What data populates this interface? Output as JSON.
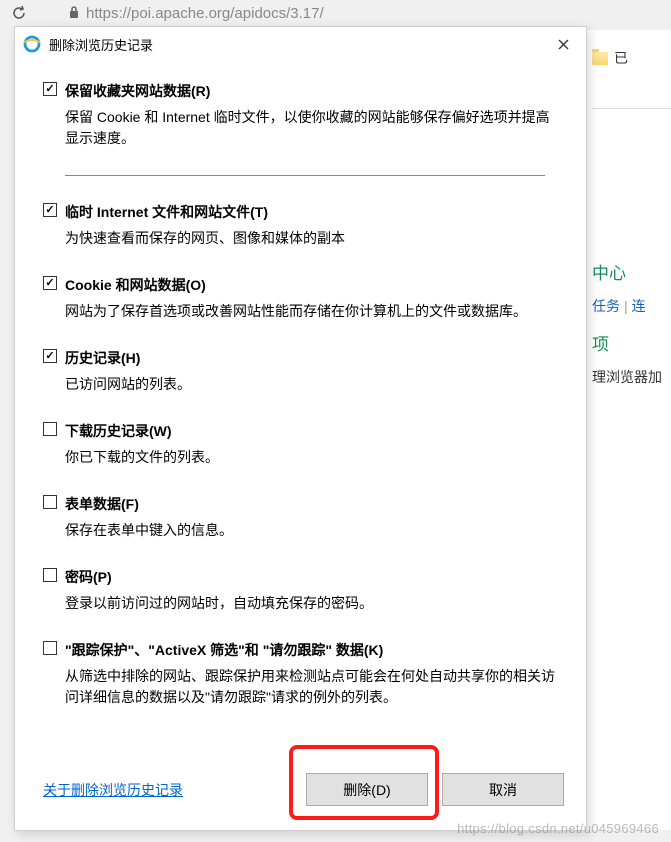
{
  "browser": {
    "url": "https://poi.apache.org/apidocs/3.17/"
  },
  "background": {
    "folder_label": "已",
    "center": "中心",
    "tasks": "任务",
    "link2": "连",
    "item": "项",
    "text": "理浏览器加"
  },
  "dialog": {
    "title": "删除浏览历史记录",
    "items": [
      {
        "checked": true,
        "label": "保留收藏夹网站数据(R)",
        "desc": "保留 Cookie 和 Internet 临时文件，以使你收藏的网站能够保存偏好选项并提高显示速度。"
      },
      {
        "checked": true,
        "label": "临时 Internet 文件和网站文件(T)",
        "desc": "为快速查看而保存的网页、图像和媒体的副本"
      },
      {
        "checked": true,
        "label": "Cookie 和网站数据(O)",
        "desc": "网站为了保存首选项或改善网站性能而存储在你计算机上的文件或数据库。"
      },
      {
        "checked": true,
        "label": "历史记录(H)",
        "desc": "已访问网站的列表。"
      },
      {
        "checked": false,
        "label": "下载历史记录(W)",
        "desc": "你已下载的文件的列表。"
      },
      {
        "checked": false,
        "label": "表单数据(F)",
        "desc": "保存在表单中键入的信息。"
      },
      {
        "checked": false,
        "label": "密码(P)",
        "desc": "登录以前访问过的网站时，自动填充保存的密码。"
      },
      {
        "checked": false,
        "label": "\"跟踪保护\"、\"ActiveX 筛选\"和 \"请勿跟踪\" 数据(K)",
        "desc": "从筛选中排除的网站、跟踪保护用来检测站点可能会在何处自动共享你的相关访问详细信息的数据以及\"请勿跟踪\"请求的例外的列表。"
      }
    ],
    "help_link": "关于删除浏览历史记录",
    "delete_btn": "删除(D)",
    "cancel_btn": "取消"
  },
  "watermark": "https://blog.csdn.net/u045969466"
}
